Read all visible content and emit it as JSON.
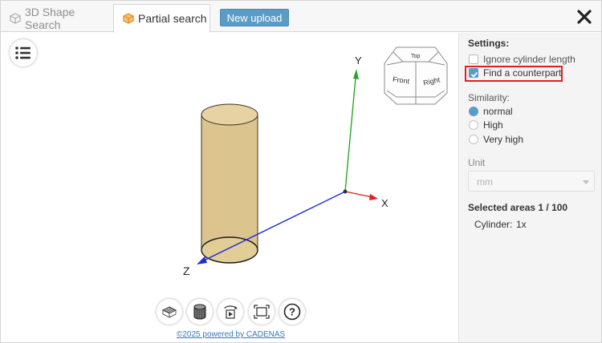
{
  "tabs": [
    {
      "label": "3D Shape Search",
      "icon": "cube-icon",
      "active": false
    },
    {
      "label": "Partial search",
      "icon": "cube-orange-icon",
      "active": true
    }
  ],
  "toolbar": {
    "new_upload_label": "New upload",
    "close_icon": "close-icon"
  },
  "viewport": {
    "axis_labels": {
      "x": "X",
      "y": "Y",
      "z": "Z"
    },
    "viewcube": {
      "top": "Top",
      "front": "Front",
      "right": "Right"
    },
    "tools": [
      "wireframe-icon",
      "shaded-cylinder-icon",
      "rotate-play-icon",
      "fit-view-icon",
      "help-icon"
    ],
    "help_glyph": "?",
    "powered_by": "©2025 powered by CADENAS"
  },
  "settings": {
    "title": "Settings:",
    "ignore_cylinder_label": "Ignore cylinder length",
    "ignore_cylinder_checked": false,
    "find_counterpart_label": "Find a counterpart",
    "find_counterpart_checked": true
  },
  "similarity": {
    "label": "Similarity:",
    "options": [
      "normal",
      "High",
      "Very high"
    ],
    "selected": "normal"
  },
  "unit": {
    "label": "Unit",
    "value": "mm"
  },
  "selected_areas": {
    "label": "Selected areas 1 / 100",
    "item_label": "Cylinder:",
    "item_value": "1x"
  },
  "colors": {
    "accent": "#5b9cc7",
    "highlight": "#e02020",
    "cylinder": "#dcc48f",
    "x_axis": "#e02020",
    "y_axis": "#2aa52a",
    "z_axis": "#1e2fd6"
  }
}
